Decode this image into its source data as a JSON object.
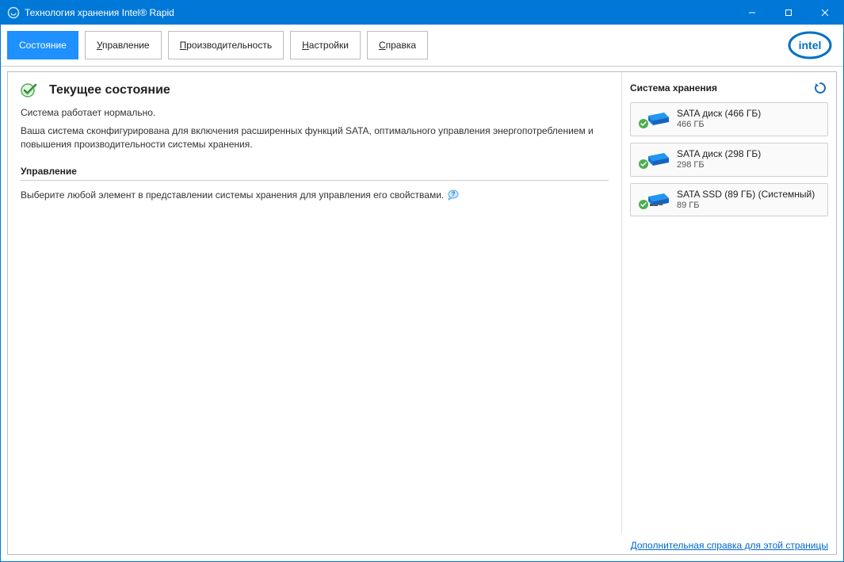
{
  "window": {
    "title": "Технология хранения Intel® Rapid"
  },
  "tabs": {
    "status": "Состояние",
    "manage_pre": "У",
    "manage_rest": "правление",
    "perf_pre": "П",
    "perf_rest": "роизводительность",
    "settings_pre": "Н",
    "settings_rest": "астройки",
    "help_pre": "С",
    "help_rest": "правка"
  },
  "main": {
    "title": "Текущее состояние",
    "ok_line": "Система работает нормально.",
    "desc": "Ваша система сконфигурирована для включения расширенных функций SATA, оптимального управления энергопотреблением и повышения производительности системы хранения.",
    "manage_heading": "Управление",
    "hint": "Выберите любой элемент в представлении системы хранения для управления его свойствами."
  },
  "side": {
    "title": "Система хранения",
    "devices": [
      {
        "name": "SATA диск (466 ГБ)",
        "size": "466 ГБ",
        "kind": "hdd"
      },
      {
        "name": "SATA диск (298 ГБ)",
        "size": "298 ГБ",
        "kind": "hdd"
      },
      {
        "name": "SATA SSD (89 ГБ) (Системный)",
        "size": "89 ГБ",
        "kind": "ssd"
      }
    ]
  },
  "footer": {
    "link": "Дополнительная справка для этой страницы"
  }
}
